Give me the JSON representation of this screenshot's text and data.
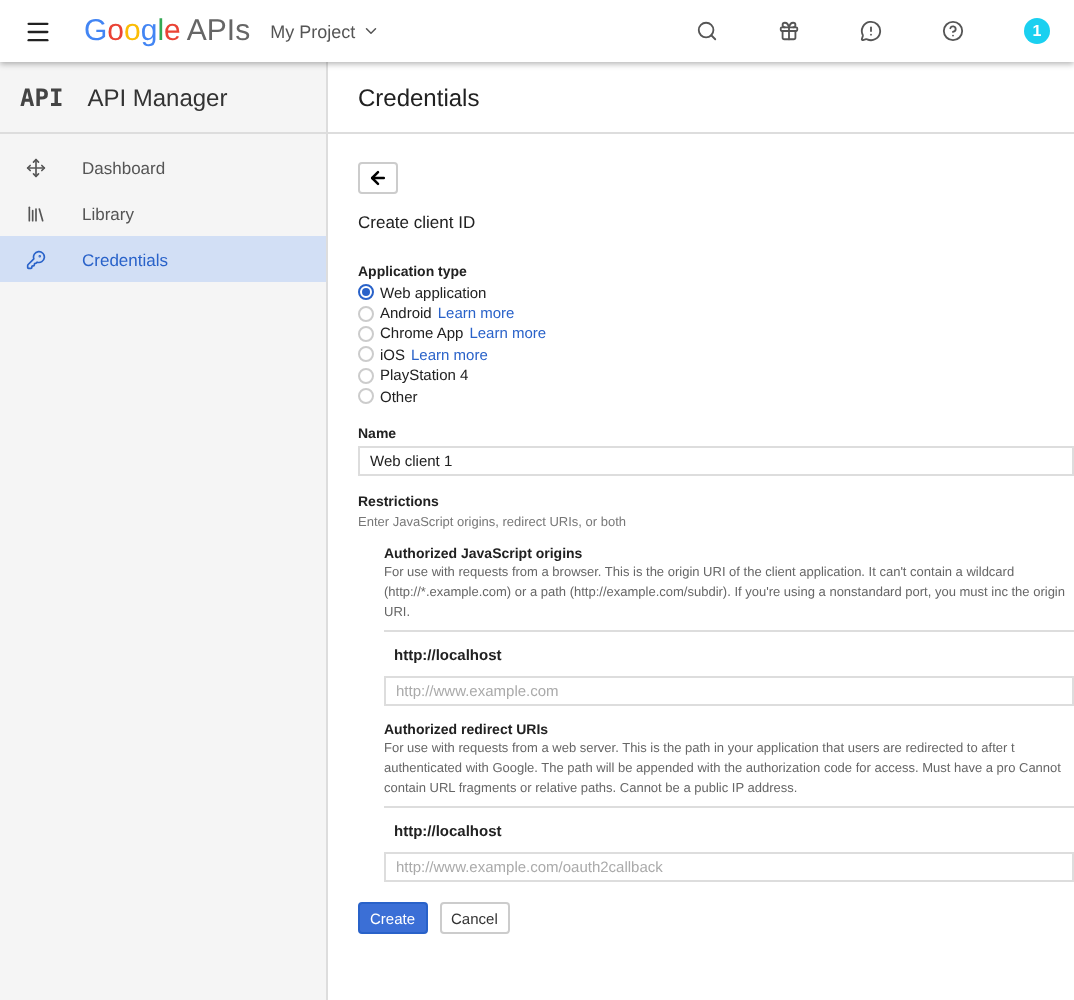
{
  "topbar": {
    "brand": "Google",
    "product": "APIs",
    "project": "My Project",
    "avatar": "1"
  },
  "sidebar": {
    "logo": "API",
    "title": "API Manager",
    "items": [
      {
        "label": "Dashboard",
        "kind": "dashboard",
        "selected": false
      },
      {
        "label": "Library",
        "kind": "library",
        "selected": false
      },
      {
        "label": "Credentials",
        "kind": "credentials",
        "selected": true
      }
    ]
  },
  "page": {
    "title": "Credentials",
    "heading": "Create client ID",
    "application_type": {
      "label": "Application type",
      "options": [
        {
          "label": "Web application",
          "selected": true
        },
        {
          "label": "Android",
          "link": "Learn more",
          "selected": false
        },
        {
          "label": "Chrome App",
          "link": "Learn more",
          "selected": false
        },
        {
          "label": "iOS",
          "link": "Learn more",
          "selected": false
        },
        {
          "label": "PlayStation 4",
          "selected": false
        },
        {
          "label": "Other",
          "selected": false
        }
      ]
    },
    "name": {
      "label": "Name",
      "value": "Web client 1"
    },
    "restrictions": {
      "label": "Restrictions",
      "hint": "Enter JavaScript origins, redirect URIs, or both",
      "sections": [
        {
          "title": "Authorized JavaScript origins",
          "description": "For use with requests from a browser. This is the origin URI of the client application. It can't contain a wildcard (http://*.example.com) or a path (http://example.com/subdir). If you're using a nonstandard port, you must inc the origin URI.",
          "entry": "http://localhost",
          "placeholder": "http://www.example.com"
        },
        {
          "title": "Authorized redirect URIs",
          "description": "For use with requests from a web server. This is the path in your application that users are redirected to after t authenticated with Google. The path will be appended with the authorization code for access. Must have a pro Cannot contain URL fragments or relative paths. Cannot be a public IP address.",
          "entry": "http://localhost",
          "placeholder": "http://www.example.com/oauth2callback"
        }
      ]
    },
    "buttons": [
      "Create",
      "Cancel"
    ]
  }
}
